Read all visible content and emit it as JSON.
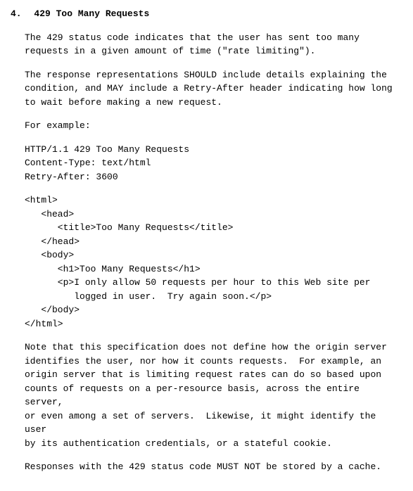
{
  "section": {
    "number": "4.",
    "title": "429 Too Many Requests"
  },
  "paragraphs": {
    "p1": "The 429 status code indicates that the user has sent too many\nrequests in a given amount of time (\"rate limiting\").",
    "p2": "The response representations SHOULD include details explaining the\ncondition, and MAY include a Retry-After header indicating how long\nto wait before making a new request.",
    "p3": "For example:",
    "code1": "HTTP/1.1 429 Too Many Requests\nContent-Type: text/html\nRetry-After: 3600",
    "code2": "<html>\n   <head>\n      <title>Too Many Requests</title>\n   </head>\n   <body>\n      <h1>Too Many Requests</h1>\n      <p>I only allow 50 requests per hour to this Web site per\n         logged in user.  Try again soon.</p>\n   </body>\n</html>",
    "p4": "Note that this specification does not define how the origin server\nidentifies the user, nor how it counts requests.  For example, an\norigin server that is limiting request rates can do so based upon\ncounts of requests on a per-resource basis, across the entire server,\nor even among a set of servers.  Likewise, it might identify the user\nby its authentication credentials, or a stateful cookie.",
    "p5": "Responses with the 429 status code MUST NOT be stored by a cache."
  }
}
